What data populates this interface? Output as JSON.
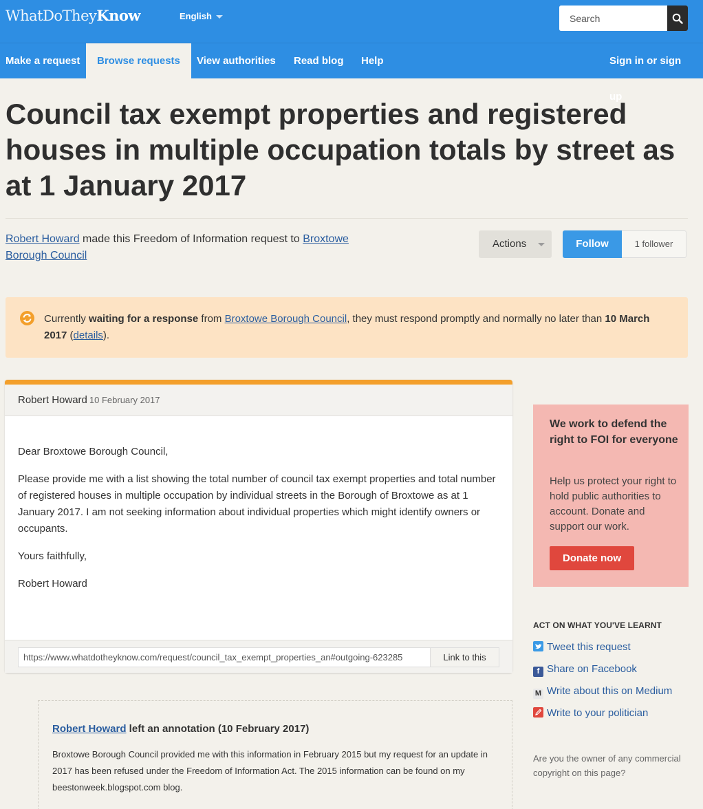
{
  "header": {
    "logo_part1": "WhatDoThey",
    "logo_part2": "Know",
    "language": "English",
    "search_placeholder": "Search"
  },
  "nav": {
    "items": [
      {
        "label": "Make a request"
      },
      {
        "label": "Browse requests"
      },
      {
        "label": "View authorities"
      },
      {
        "label": "Read blog"
      },
      {
        "label": "Help"
      }
    ],
    "sign_in": "Sign in or sign up"
  },
  "request": {
    "title": "Council tax exempt properties and registered houses in multiple occupation totals by street as at 1 January 2017",
    "requester": "Robert Howard",
    "byline_mid": " made this Freedom of Information request to ",
    "authority": "Broxtowe Borough Council",
    "actions_label": "Actions",
    "follow_label": "Follow",
    "follower_count": "1 follower"
  },
  "status": {
    "pre": "Currently ",
    "state": "waiting for a response",
    "from": " from ",
    "authority": "Broxtowe Borough Council",
    "mid": ", they must respond promptly and normally no later than ",
    "deadline": "10 March 2017",
    "open_paren": " (",
    "details_link": "details",
    "close_paren": ")."
  },
  "message": {
    "author": "Robert Howard",
    "date": "10 February 2017",
    "greeting": "Dear Broxtowe Borough Council,",
    "body": "Please provide me with a list showing the total number of council tax exempt properties and total number of registered houses in multiple occupation by individual streets in the Borough of Broxtowe as at 1 January 2017. I am not seeking information about individual properties which might identify owners or occupants.",
    "signoff": "Yours faithfully,",
    "signature": "Robert Howard",
    "permalink": "https://www.whatdotheyknow.com/request/council_tax_exempt_properties_an#outgoing-623285",
    "link_button": "Link to this"
  },
  "annotation": {
    "author": "Robert Howard",
    "head_rest": " left an annotation (10 February 2017)",
    "text": "Broxtowe Borough Council provided me with this information in February 2015 but my request for an update in 2017 has been refused under the Freedom of Information Act. The 2015 information can be found on my beestonweek.blogspot.com blog."
  },
  "sidebar": {
    "promo_heading": "We work to defend the right to FOI for everyone",
    "promo_text": "Help us protect your right to hold public authorities to account. Donate and support our work.",
    "donate_button": "Donate now",
    "share_heading": "ACT ON WHAT YOU'VE LEARNT",
    "share_items": [
      {
        "label": "Tweet this request",
        "icon": "twitter-icon",
        "color": "#3a9ae6"
      },
      {
        "label": "Share on Facebook",
        "icon": "facebook-icon",
        "color": "#3b5998"
      },
      {
        "label": "Write about this on Medium",
        "icon": "medium-icon",
        "color": "#cfcfcf"
      },
      {
        "label": "Write to your politician",
        "icon": "politician-icon",
        "color": "#e0473d"
      }
    ],
    "owner_question": "Are you the owner of any commercial copyright on this page?"
  },
  "colors": {
    "brand_blue": "#2e8ee3",
    "status_bg": "#fde3c4",
    "accent_orange": "#f39f2b",
    "donate_red": "#e0473d",
    "promo_pink": "#f4b8b2"
  }
}
